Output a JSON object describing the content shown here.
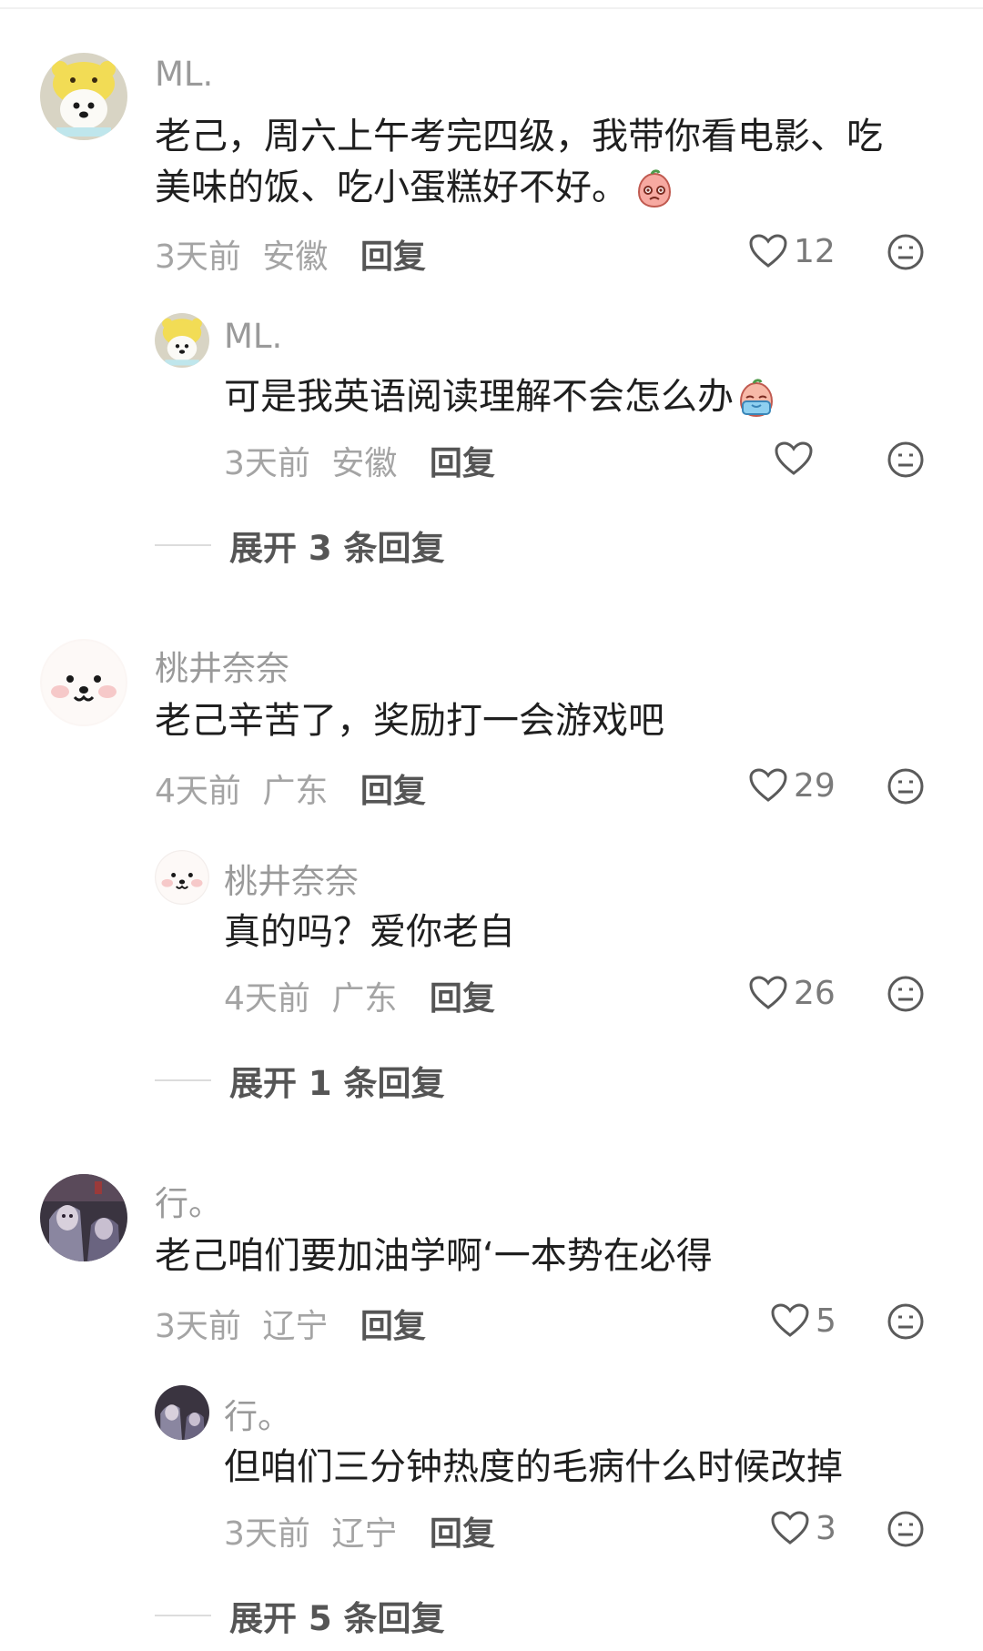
{
  "threads": [
    {
      "comment": {
        "username": "ML.",
        "text_line1": "老己，周六上午考完四级，我带你看电影、吃",
        "text_line2": "美味的饭、吃小蛋糕好不好。",
        "emoji": "shy-peach-emoji",
        "time": "3天前",
        "location": "安徽",
        "reply_label": "回复",
        "likes": "12",
        "avatar": "puppy-hat-avatar"
      },
      "reply": {
        "username": "ML.",
        "text": "可是我英语阅读理解不会怎么办",
        "emoji": "crying-peach-emoji",
        "time": "3天前",
        "location": "安徽",
        "reply_label": "回复",
        "likes": "",
        "avatar": "puppy-hat-avatar"
      },
      "expand_label": "展开 3 条回复"
    },
    {
      "comment": {
        "username": "桃井奈奈",
        "text": "老己辛苦了，奖励打一会游戏吧",
        "time": "4天前",
        "location": "广东",
        "reply_label": "回复",
        "likes": "29",
        "avatar": "white-bear-avatar"
      },
      "reply": {
        "username": "桃井奈奈",
        "text": "真的吗？爱你老自",
        "time": "4天前",
        "location": "广东",
        "reply_label": "回复",
        "likes": "26",
        "avatar": "white-bear-avatar"
      },
      "expand_label": "展开 1 条回复"
    },
    {
      "comment": {
        "username": "行。",
        "text": "老己咱们要加油学啊‘一本势在必得",
        "time": "3天前",
        "location": "辽宁",
        "reply_label": "回复",
        "likes": "5",
        "avatar": "anime-dark-avatar"
      },
      "reply": {
        "username": "行。",
        "text": "但咱们三分钟热度的毛病什么时候改掉",
        "time": "3天前",
        "location": "辽宁",
        "reply_label": "回复",
        "likes": "3",
        "avatar": "anime-dark-avatar"
      },
      "expand_label": "展开 5 条回复"
    }
  ],
  "icons": {
    "like": "heart-outline-icon",
    "dislike": "frown-face-icon"
  },
  "colors": {
    "username": "#9a9a9a",
    "meta": "#a4a4a4",
    "reply_link": "#555555",
    "text": "#1f1f1f"
  }
}
